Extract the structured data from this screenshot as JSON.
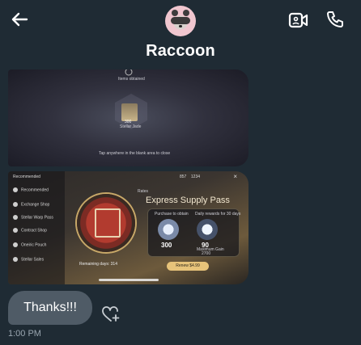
{
  "header": {
    "contact_name": "Raccoon",
    "back_icon": "arrow-left-icon",
    "video_icon": "video-call-icon",
    "call_icon": "phone-icon"
  },
  "messages": {
    "image1": {
      "items_obtained": "Items obtained",
      "item_name": "Stellar Jade",
      "item_count": "300",
      "hint": "Tap anywhere in the blank area to close"
    },
    "image2": {
      "sidebar_title": "Recommended",
      "nav": [
        "Recommended",
        "Exchange Shop",
        "Stellar Warp Pass",
        "Contract Shop",
        "Oneiric Pouch",
        "Stellar Sales"
      ],
      "top_values": [
        "857",
        "1234"
      ],
      "tag": "Rates",
      "pass_title": "Express Supply Pass",
      "purchase_label": "Purchase to obtain",
      "daily_label": "Daily rewards for 30 days",
      "purchase_value": "300",
      "daily_value": "90",
      "max_gain_label": "Maximum Gain",
      "max_gain_value": "2700",
      "remaining": "Remaining days: 314",
      "renew_button": "Renew $4.99"
    },
    "bubble_text": "Thanks!!!",
    "timestamp": "1:00 PM"
  },
  "colors": {
    "background": "#1f2b34",
    "bubble": "#4f5b66",
    "muted_text": "#9aa6b0"
  }
}
